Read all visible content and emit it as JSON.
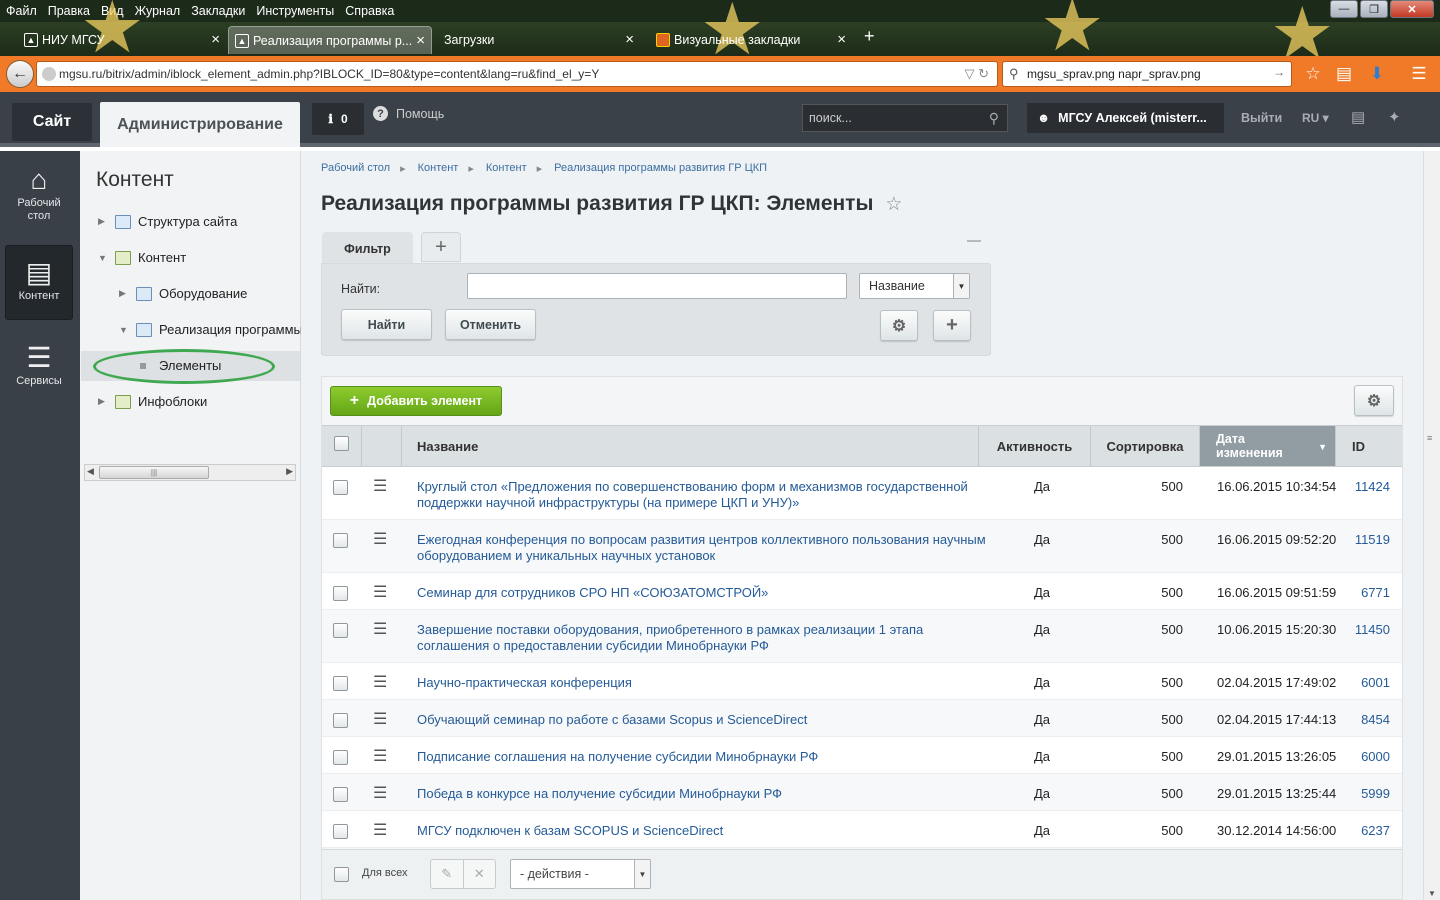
{
  "browser": {
    "menu": [
      "Файл",
      "Правка",
      "Вид",
      "Журнал",
      "Закладки",
      "Инструменты",
      "Справка"
    ],
    "tabs": [
      {
        "label": "НИУ МГСУ"
      },
      {
        "label": "Реализация программы р..."
      },
      {
        "label": "Загрузки"
      },
      {
        "label": "Визуальные закладки"
      }
    ],
    "url": "mgsu.ru/bitrix/admin/iblock_element_admin.php?IBLOCK_ID=80&type=content&lang=ru&find_el_y=Y",
    "search_value": "mgsu_sprav.png napr_sprav.png"
  },
  "panel": {
    "site_tab": "Сайт",
    "admin_tab": "Администрирование",
    "notifications_count": "0",
    "help": "Помощь",
    "search_placeholder": "поиск...",
    "user": "МГСУ Алексей (misterr...",
    "logout": "Выйти",
    "lang": "RU"
  },
  "leftmenu": {
    "desktop": "Рабочий стол",
    "content": "Контент",
    "services": "Сервисы"
  },
  "tree": {
    "title": "Контент",
    "items": [
      {
        "label": "Структура сайта"
      },
      {
        "label": "Контент"
      },
      {
        "label": "Оборудование"
      },
      {
        "label": "Реализация программы"
      },
      {
        "label": "Элементы"
      },
      {
        "label": "Инфоблоки"
      }
    ]
  },
  "breadcrumbs": [
    "Рабочий стол",
    "Контент",
    "Контент",
    "Реализация программы развития ГР ЦКП"
  ],
  "page_title": "Реализация программы развития ГР ЦКП: Элементы",
  "filter": {
    "tab": "Фильтр",
    "find_label": "Найти:",
    "find_value": "",
    "field_select": "Название",
    "find_button": "Найти",
    "cancel_button": "Отменить"
  },
  "list": {
    "add_button": "Добавить элемент",
    "columns": {
      "name": "Название",
      "active": "Активность",
      "sort": "Сортировка",
      "date": "Дата изменения",
      "id": "ID"
    },
    "rows": [
      {
        "name": "Круглый стол «Предложения по совершенствованию форм и механизмов государственной поддержки научной инфраструктуры (на примере ЦКП и УНУ)»",
        "active": "Да",
        "sort": "500",
        "date": "16.06.2015 10:34:54",
        "id": "11424"
      },
      {
        "name": "Ежегодная конференция по вопросам развития центров коллективного пользования научным оборудованием и уникальных научных установок",
        "active": "Да",
        "sort": "500",
        "date": "16.06.2015 09:52:20",
        "id": "11519"
      },
      {
        "name": "Семинар для сотрудников СРО НП «СОЮЗАТОМСТРОЙ»",
        "active": "Да",
        "sort": "500",
        "date": "16.06.2015 09:51:59",
        "id": "6771"
      },
      {
        "name": "Завершение поставки оборудования, приобретенного в рамках реализации 1 этапа соглашения о предоставлении субсидии Минобрнауки РФ",
        "active": "Да",
        "sort": "500",
        "date": "10.06.2015 15:20:30",
        "id": "11450"
      },
      {
        "name": "Научно-практическая конференция",
        "active": "Да",
        "sort": "500",
        "date": "02.04.2015 17:49:02",
        "id": "6001"
      },
      {
        "name": "Обучающий семинар по работе с базами Scopus и ScienceDirect",
        "active": "Да",
        "sort": "500",
        "date": "02.04.2015 17:44:13",
        "id": "8454"
      },
      {
        "name": "Подписание соглашения на получение субсидии Минобрнауки РФ",
        "active": "Да",
        "sort": "500",
        "date": "29.01.2015 13:26:05",
        "id": "6000"
      },
      {
        "name": "Победа в конкурсе на получение субсидии Минобрнауки РФ",
        "active": "Да",
        "sort": "500",
        "date": "29.01.2015 13:25:44",
        "id": "5999"
      },
      {
        "name": "МГСУ подключен к базам SCOPUS и ScienceDirect",
        "active": "Да",
        "sort": "500",
        "date": "30.12.2014 14:56:00",
        "id": "6237"
      }
    ],
    "footer_all": "Для всех",
    "actions_select": "- действия -"
  }
}
